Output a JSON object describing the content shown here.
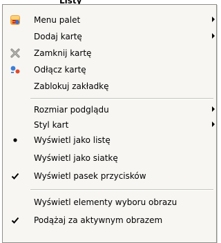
{
  "behind_title": "Listy",
  "menu": {
    "items": [
      {
        "label": "Menu palet",
        "has_submenu": true,
        "icon": "palette-menu-icon"
      },
      {
        "label": "Dodaj kartę",
        "has_submenu": true
      },
      {
        "label": "Zamknij kartę",
        "icon": "close-tab-icon"
      },
      {
        "label": "Odłącz kartę",
        "icon": "detach-tab-icon"
      },
      {
        "label": "Zablokuj zakładkę"
      },
      {
        "label": "Rozmiar podglądu",
        "has_submenu": true
      },
      {
        "label": "Styl kart",
        "has_submenu": true
      },
      {
        "label": "Wyświetl jako listę",
        "state": "radio-selected"
      },
      {
        "label": "Wyświetl jako siatkę"
      },
      {
        "label": "Wyświetl pasek przycisków",
        "state": "checked"
      },
      {
        "label": "Wyświetl elementy wyboru obrazu"
      },
      {
        "label": "Podążaj za aktywnym obrazem",
        "state": "checked"
      }
    ]
  },
  "colors": {
    "menu_bg": "#f7f6f3",
    "border": "#8e8d89",
    "separator": "#c5c4c0"
  }
}
